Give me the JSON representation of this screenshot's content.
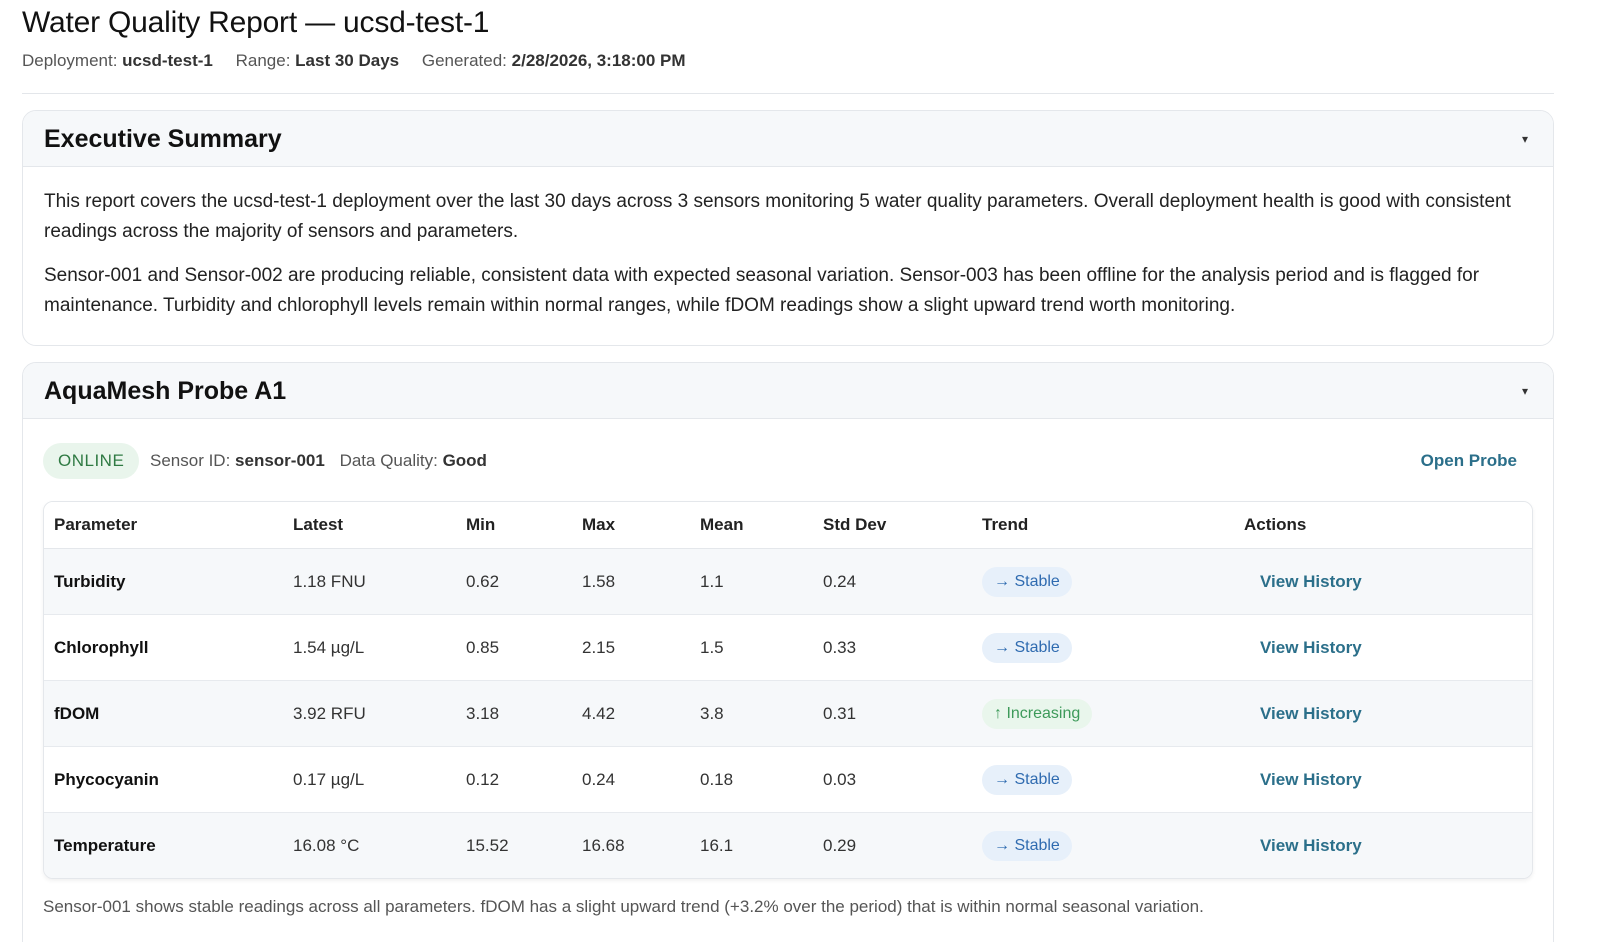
{
  "report": {
    "title": "Water Quality Report — ucsd-test-1",
    "meta": {
      "deployment_label": "Deployment:",
      "deployment_value": "ucsd-test-1",
      "range_label": "Range:",
      "range_value": "Last 30 Days",
      "generated_label": "Generated:",
      "generated_value": "2/28/2026, 3:18:00 PM"
    }
  },
  "executive_summary": {
    "title": "Executive Summary",
    "toggle_icon": "▾",
    "paragraphs": [
      "This report covers the ucsd-test-1 deployment over the last 30 days across 3 sensors monitoring 5 water quality parameters. Overall deployment health is good with consistent readings across the majority of sensors and parameters.",
      "Sensor-001 and Sensor-002 are producing reliable, consistent data with expected seasonal variation. Sensor-003 has been offline for the analysis period and is flagged for maintenance. Turbidity and chlorophyll levels remain within normal ranges, while fDOM readings show a slight upward trend worth monitoring."
    ]
  },
  "probe": {
    "title": "AquaMesh Probe A1",
    "toggle_icon": "▾",
    "status": "ONLINE",
    "sensor_id_label": "Sensor ID:",
    "sensor_id_value": "sensor-001",
    "data_quality_label": "Data Quality:",
    "data_quality_value": "Good",
    "open_probe_label": "Open Probe",
    "table": {
      "headers": [
        "Parameter",
        "Latest",
        "Min",
        "Max",
        "Mean",
        "Std Dev",
        "Trend",
        "Actions"
      ],
      "rows": [
        {
          "parameter": "Turbidity",
          "latest": "1.18 FNU",
          "min": "0.62",
          "max": "1.58",
          "mean": "1.1",
          "std": "0.24",
          "trend": "→ Stable",
          "action": "View History"
        },
        {
          "parameter": "Chlorophyll",
          "latest": "1.54 µg/L",
          "min": "0.85",
          "max": "2.15",
          "mean": "1.5",
          "std": "0.33",
          "trend": "→ Stable",
          "action": "View History"
        },
        {
          "parameter": "fDOM",
          "latest": "3.92 RFU",
          "min": "3.18",
          "max": "4.42",
          "mean": "3.8",
          "std": "0.31",
          "trend": "↑ Increasing",
          "action": "View History"
        },
        {
          "parameter": "Phycocyanin",
          "latest": "0.17 µg/L",
          "min": "0.12",
          "max": "0.24",
          "mean": "0.18",
          "std": "0.03",
          "trend": "→ Stable",
          "action": "View History"
        },
        {
          "parameter": "Temperature",
          "latest": "16.08 °C",
          "min": "15.52",
          "max": "16.68",
          "mean": "16.1",
          "std": "0.29",
          "trend": "→ Stable",
          "action": "View History"
        }
      ]
    },
    "note": "Sensor-001 shows stable readings across all parameters. fDOM has a slight upward trend (+3.2% over the period) that is within normal seasonal variation."
  },
  "colors": {
    "accent_link": "#2b6f8a",
    "online_bg": "#e9f5ec",
    "online_text": "#2f7a43",
    "stable_bg": "#e7f0fa",
    "stable_text": "#2f6bb0",
    "increasing_bg": "#e9f6ec",
    "increasing_text": "#3d9a5a"
  }
}
